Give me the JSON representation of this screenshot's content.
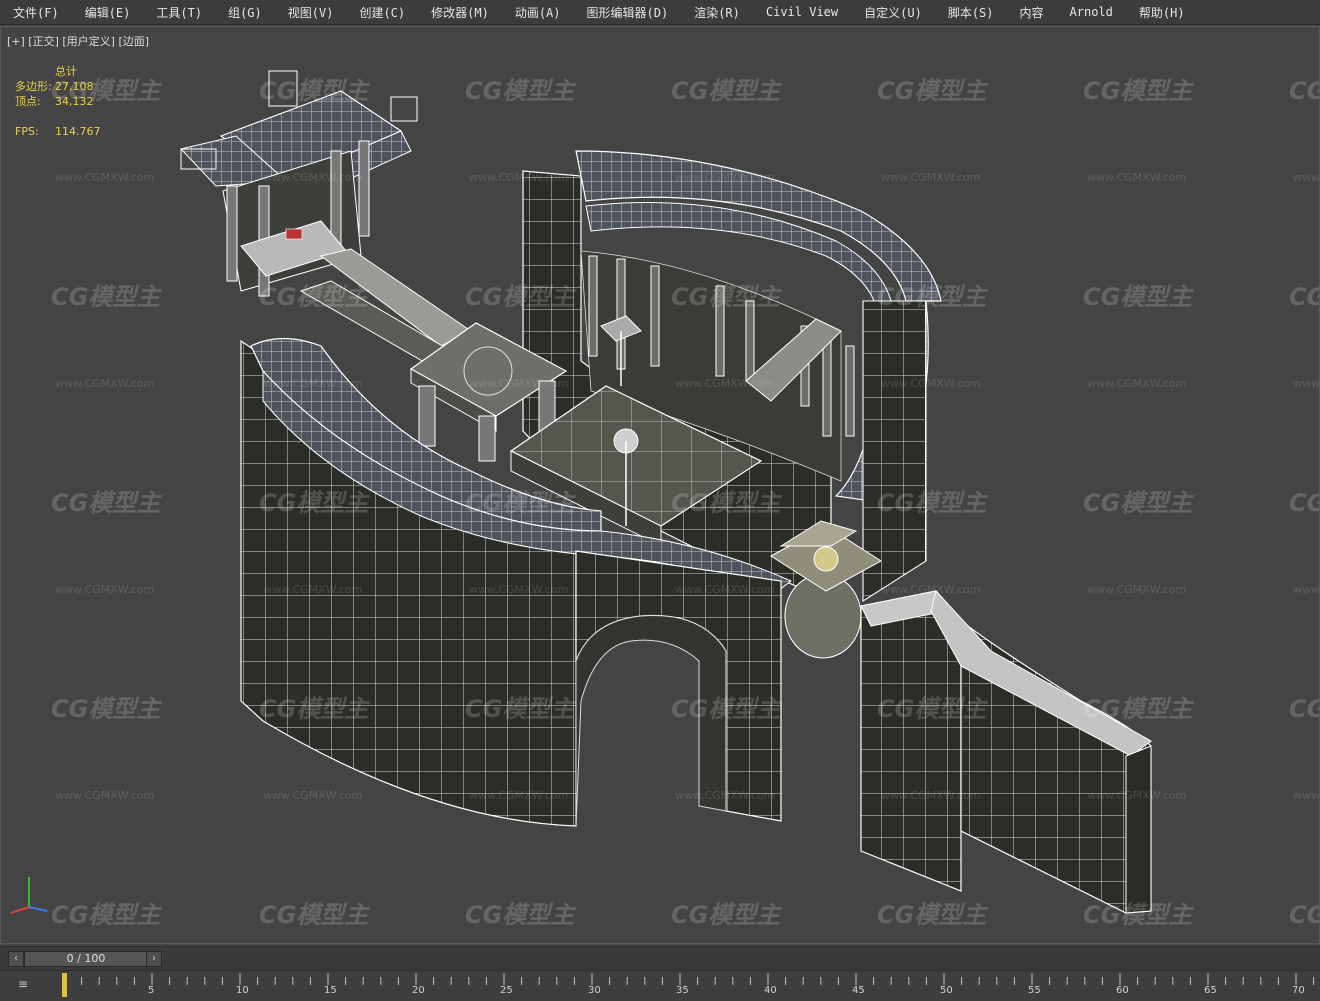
{
  "menu": {
    "items": [
      "文件(F)",
      "编辑(E)",
      "工具(T)",
      "组(G)",
      "视图(V)",
      "创建(C)",
      "修改器(M)",
      "动画(A)",
      "图形编辑器(D)",
      "渲染(R)",
      "Civil View",
      "自定义(U)",
      "脚本(S)",
      "内容",
      "Arnold",
      "帮助(H)"
    ]
  },
  "viewport": {
    "label": "[+] [正交] [用户定义] [边面]",
    "stats": {
      "title": "总计",
      "poly_label": "多边形:",
      "poly_value": "27,108",
      "vert_label": "顶点:",
      "vert_value": "34,132",
      "fps_label": "FPS:",
      "fps_value": "114.767"
    },
    "watermark": {
      "logo": "CG模型主",
      "url": "www.CGMXW.com"
    }
  },
  "timeline": {
    "frame_display": "0 / 100",
    "prev_icon": "chevron-left-icon",
    "next_icon": "chevron-right-icon",
    "ticks": [
      "5",
      "10",
      "15",
      "20",
      "25",
      "30",
      "35",
      "40",
      "45",
      "50",
      "55",
      "60",
      "65",
      "70"
    ]
  },
  "colors": {
    "viewport_bg": "#444444",
    "wire": "#ffffff",
    "stats_text": "#e8d44c",
    "menu_bg": "#3c3c3c"
  }
}
